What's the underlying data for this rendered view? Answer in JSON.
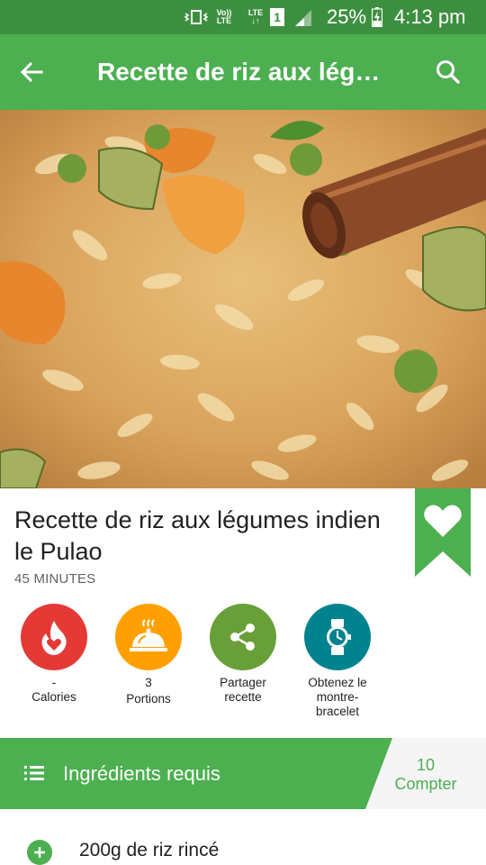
{
  "status_bar": {
    "volte_top": "Vo))",
    "volte_bottom": "LTE",
    "lte_top": "LTE",
    "lte_bottom": "↓↑",
    "sim": "1",
    "battery": "25%",
    "time": "4:13 pm",
    "icons": [
      "vibrate-icon",
      "volte-icon",
      "lte-icon",
      "sim-icon",
      "signal-icon",
      "battery-charging-icon"
    ]
  },
  "app_bar": {
    "title": "Recette de riz aux légu…",
    "back_icon": "arrow-back-icon",
    "search_icon": "search-icon"
  },
  "recipe": {
    "title": "Recette de riz aux légumes indien le Pulao",
    "time": "45 MINUTES",
    "bookmark_icon": "heart-bookmark-icon"
  },
  "actions": [
    {
      "icon": "calories-flame-icon",
      "color": "#e53935",
      "line1": "-",
      "line2": "Calories"
    },
    {
      "icon": "serving-dish-icon",
      "color": "#ffa000",
      "line1": "3",
      "line2": "Portions"
    },
    {
      "icon": "share-icon",
      "color": "#689f38",
      "line1": "Partager",
      "line2": "recette"
    },
    {
      "icon": "watch-icon",
      "color": "#00838f",
      "line1": "Obtenez le",
      "line2": "montre-",
      "line3": "bracelet"
    }
  ],
  "ingredients": {
    "header": "Ingrédients requis",
    "count": "10",
    "count_label": "Compter",
    "list_icon": "list-icon",
    "items": [
      {
        "text": "200g de riz rincé",
        "icon": "add-icon"
      }
    ]
  },
  "colors": {
    "status_bar": "#3d8f40",
    "primary": "#4caf50",
    "text": "#212121"
  }
}
